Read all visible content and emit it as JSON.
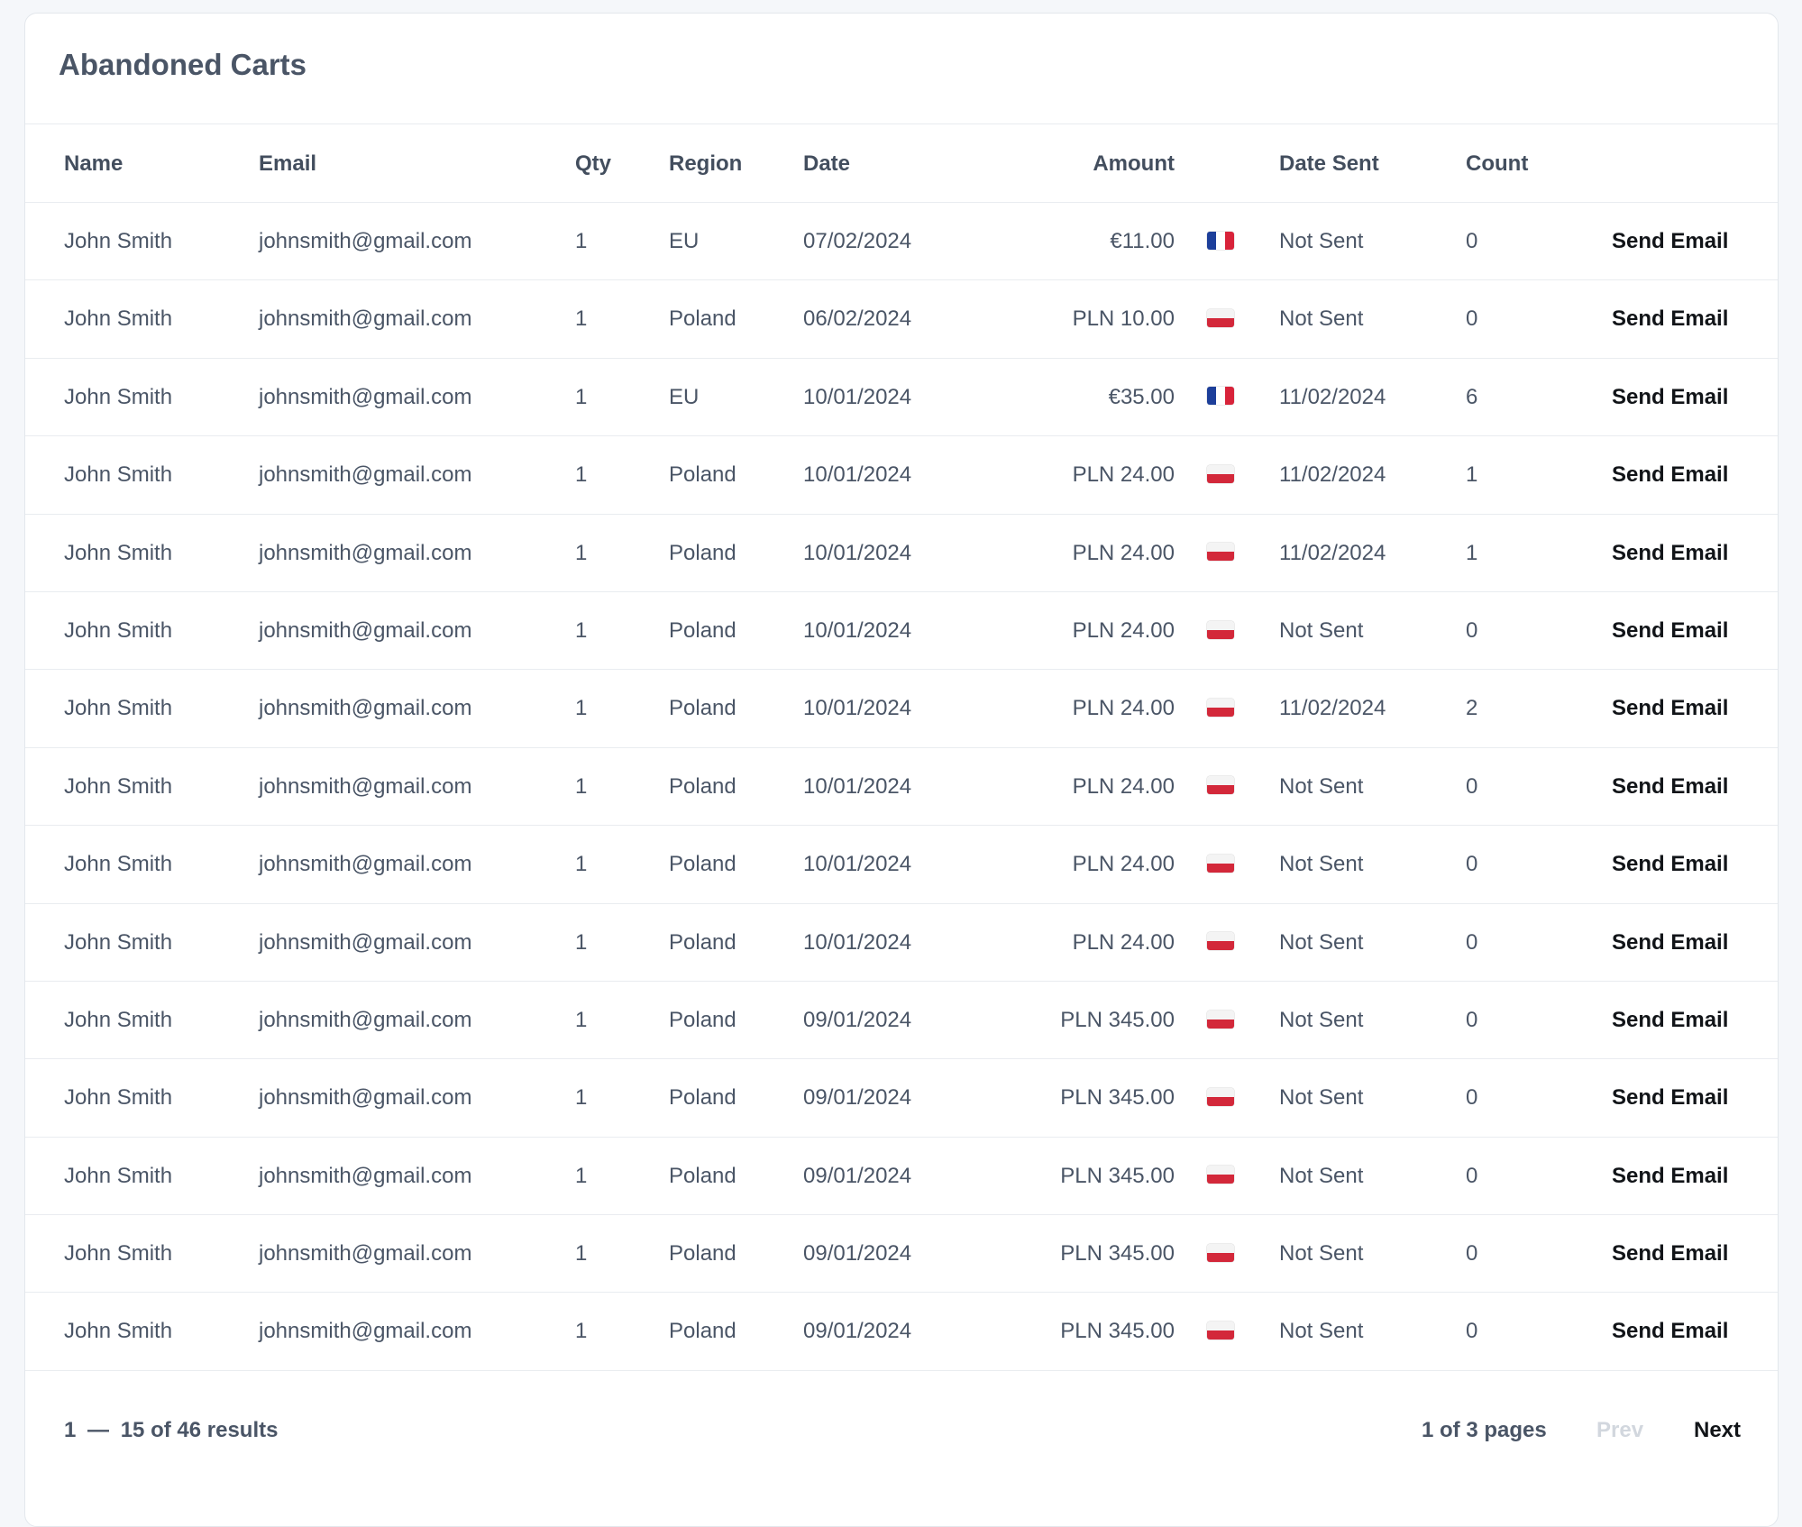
{
  "title": "Abandoned Carts",
  "columns": {
    "name": "Name",
    "email": "Email",
    "qty": "Qty",
    "region": "Region",
    "date": "Date",
    "amount": "Amount",
    "date_sent": "Date Sent",
    "count": "Count"
  },
  "rows": [
    {
      "name": "John Smith",
      "email": "johnsmith@gmail.com",
      "qty": "1",
      "region": "EU",
      "date": "07/02/2024",
      "amount": "€11.00",
      "flag": "france-flag",
      "date_sent": "Not Sent",
      "count": "0",
      "action": "Send Email"
    },
    {
      "name": "John Smith",
      "email": "johnsmith@gmail.com",
      "qty": "1",
      "region": "Poland",
      "date": "06/02/2024",
      "amount": "PLN 10.00",
      "flag": "poland-flag",
      "date_sent": "Not Sent",
      "count": "0",
      "action": "Send Email"
    },
    {
      "name": "John Smith",
      "email": "johnsmith@gmail.com",
      "qty": "1",
      "region": "EU",
      "date": "10/01/2024",
      "amount": "€35.00",
      "flag": "france-flag",
      "date_sent": "11/02/2024",
      "count": "6",
      "action": "Send Email"
    },
    {
      "name": "John Smith",
      "email": "johnsmith@gmail.com",
      "qty": "1",
      "region": "Poland",
      "date": "10/01/2024",
      "amount": "PLN 24.00",
      "flag": "poland-flag",
      "date_sent": "11/02/2024",
      "count": "1",
      "action": "Send Email"
    },
    {
      "name": "John Smith",
      "email": "johnsmith@gmail.com",
      "qty": "1",
      "region": "Poland",
      "date": "10/01/2024",
      "amount": "PLN 24.00",
      "flag": "poland-flag",
      "date_sent": "11/02/2024",
      "count": "1",
      "action": "Send Email"
    },
    {
      "name": "John Smith",
      "email": "johnsmith@gmail.com",
      "qty": "1",
      "region": "Poland",
      "date": "10/01/2024",
      "amount": "PLN 24.00",
      "flag": "poland-flag",
      "date_sent": "Not Sent",
      "count": "0",
      "action": "Send Email"
    },
    {
      "name": "John Smith",
      "email": "johnsmith@gmail.com",
      "qty": "1",
      "region": "Poland",
      "date": "10/01/2024",
      "amount": "PLN 24.00",
      "flag": "poland-flag",
      "date_sent": "11/02/2024",
      "count": "2",
      "action": "Send Email"
    },
    {
      "name": "John Smith",
      "email": "johnsmith@gmail.com",
      "qty": "1",
      "region": "Poland",
      "date": "10/01/2024",
      "amount": "PLN 24.00",
      "flag": "poland-flag",
      "date_sent": "Not Sent",
      "count": "0",
      "action": "Send Email"
    },
    {
      "name": "John Smith",
      "email": "johnsmith@gmail.com",
      "qty": "1",
      "region": "Poland",
      "date": "10/01/2024",
      "amount": "PLN 24.00",
      "flag": "poland-flag",
      "date_sent": "Not Sent",
      "count": "0",
      "action": "Send Email"
    },
    {
      "name": "John Smith",
      "email": "johnsmith@gmail.com",
      "qty": "1",
      "region": "Poland",
      "date": "10/01/2024",
      "amount": "PLN 24.00",
      "flag": "poland-flag",
      "date_sent": "Not Sent",
      "count": "0",
      "action": "Send Email"
    },
    {
      "name": "John Smith",
      "email": "johnsmith@gmail.com",
      "qty": "1",
      "region": "Poland",
      "date": "09/01/2024",
      "amount": "PLN 345.00",
      "flag": "poland-flag",
      "date_sent": "Not Sent",
      "count": "0",
      "action": "Send Email"
    },
    {
      "name": "John Smith",
      "email": "johnsmith@gmail.com",
      "qty": "1",
      "region": "Poland",
      "date": "09/01/2024",
      "amount": "PLN 345.00",
      "flag": "poland-flag",
      "date_sent": "Not Sent",
      "count": "0",
      "action": "Send Email"
    },
    {
      "name": "John Smith",
      "email": "johnsmith@gmail.com",
      "qty": "1",
      "region": "Poland",
      "date": "09/01/2024",
      "amount": "PLN 345.00",
      "flag": "poland-flag",
      "date_sent": "Not Sent",
      "count": "0",
      "action": "Send Email"
    },
    {
      "name": "John Smith",
      "email": "johnsmith@gmail.com",
      "qty": "1",
      "region": "Poland",
      "date": "09/01/2024",
      "amount": "PLN 345.00",
      "flag": "poland-flag",
      "date_sent": "Not Sent",
      "count": "0",
      "action": "Send Email"
    },
    {
      "name": "John Smith",
      "email": "johnsmith@gmail.com",
      "qty": "1",
      "region": "Poland",
      "date": "09/01/2024",
      "amount": "PLN 345.00",
      "flag": "poland-flag",
      "date_sent": "Not Sent",
      "count": "0",
      "action": "Send Email"
    }
  ],
  "pagination": {
    "range_start": "1",
    "range_dash": "—",
    "range_rest": "15 of 46 results",
    "pages": "1 of 3 pages",
    "prev": "Prev",
    "next": "Next"
  },
  "colors": {
    "page_bg": "#f5f7fa",
    "card_bg": "#ffffff",
    "border": "#e9ecf0",
    "text": "#4a5566",
    "action_text": "#111418",
    "disabled_text": "#d2d7de"
  }
}
